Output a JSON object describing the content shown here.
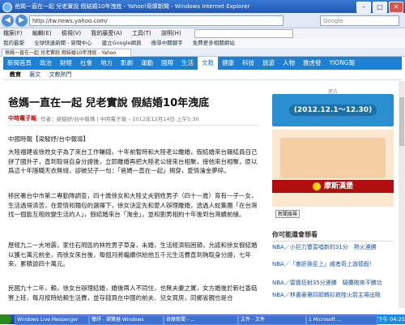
{
  "window": {
    "title": "爸媽一直在一起 兒老實說 假結婚10年洩底 - Yahoo!奇摩新聞 - Windows Internet Explorer",
    "address": "http://tw.news.yahoo.com/",
    "search_placeholder": "Google"
  },
  "menubar": [
    "檔案(F)",
    "編輯(E)",
    "檢視(V)",
    "我的最愛(A)",
    "工具(T)",
    "說明(H)"
  ],
  "favorites": [
    "我的最愛",
    "全球快速新聞 - 新聞中心",
    "建立Google網頁",
    "搜尋中關鍵字",
    "免費更多相關網站"
  ],
  "tab": {
    "label": "爸媽一直在一起 兒老實說 假結婚10年洩底 - Yahoo"
  },
  "site_nav": [
    "新聞首頁",
    "政治",
    "財經",
    "社會",
    "地方",
    "影劇",
    "運動",
    "國際",
    "生活",
    "文教",
    "健康",
    "科技",
    "旅遊",
    "人物",
    "雅虎發",
    "YIONG報"
  ],
  "site_nav_active": "文教",
  "subnav": [
    "教育",
    "藝文",
    "文教熱門"
  ],
  "article": {
    "headline": "爸媽一直在一起 兒老實說 假結婚10年洩底",
    "source_logo": "中時電子報",
    "byline": "作者：梁駿妤/台中報導 | 中時電子報 – 2012年12月14日 上午5:30",
    "paragraphs": [
      "中國時報【梁駿妤/台中報導】",
      "大陸福建省徐姓女子為了來台工作賺錢，十年前暫時和大陸老公離婚，假結婚來台縣結員自己拼了國外子，直到取得自身分證後，立即離婚再把大陸老公接來台相聚，接他來台相聚，原以爲這十年隱瞞天衣無縫，卻被兒子一句：「爸媽一直在一起」揭穿，愛情淪金夢碎。",
      "移民署台中市第二專勤隊調查，四十歲徐女和大陸丈夫劉姓男子（四十一歲）育有一子一女，生活過得清苦，在愛情和麵包的選擇下，徐女決定先和愛人辦理離婚，透過人蛇集團「在台灣找一個能互相效變生活的人」，假結婚來台「淘金」，並和劉男相約十年後到台灣續前緣。",
      "歷經九二一大地震，家住石岡區的林姓男子草身，未婚，生活經濟陷困頓，允諾和徐女假結婚以獲七萬元前金，而徐女來台後，每個月將繼續供給他五千元生活費直到夠取身分證，七年來，累積逾四十萬元。",
      "民國九十二年，賴，徐女台辦理結婚，婚後兩人不同住，也無夫妻之實，女方婚後於新社香菇寮上班，每月按時給賴生活費，並存錢買在中國的前夫、兒女買房，同鄉省親也是合"
    ]
  },
  "sidebar": {
    "ad_label": "廣告",
    "ad1_text": "(2012.12.1～12.30)",
    "ad2_brand": "摩斯漢堡",
    "search_button": "新聞搜尋",
    "may_like_title": "你可能還會想看",
    "links": [
      {
        "text": "NBA／小巨力豐富唱新的31分　熱火連勝",
        "more": ""
      },
      {
        "text": "NBA／「麥肝換臣上」威者奇上滋德殺！",
        "more": ""
      },
      {
        "text": "NBA／雷霆狂射35分連勝　騎攤敗來不勝功",
        "more": ""
      },
      {
        "text": "NBA／林書豪第四節轉衫救陸火箭主場出敗",
        "more": ""
      }
    ]
  },
  "taskbar": {
    "items": [
      "Windows Live Messenger",
      "鑒評 - 瀏覽器 Windows",
      "奇摩新聞 - ...",
      "文件 - 文件",
      "1 Microsoft ..."
    ],
    "clock": "下午 04:25"
  }
}
